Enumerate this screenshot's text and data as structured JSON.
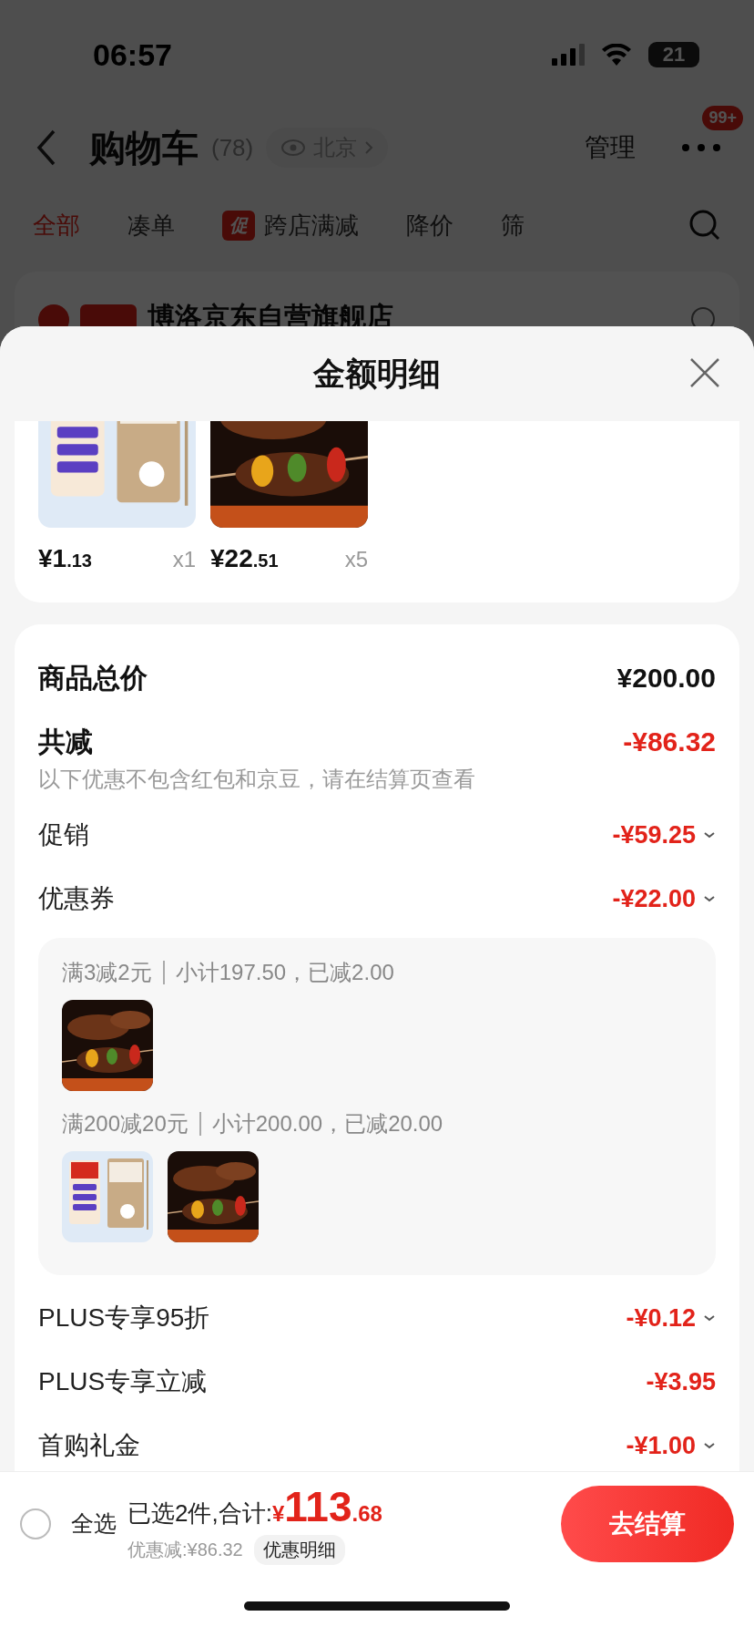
{
  "status_bar": {
    "time": "06:57",
    "battery": "21"
  },
  "header": {
    "title": "购物车",
    "count": "(78)",
    "location": "北京",
    "manage": "管理",
    "badge": "99+"
  },
  "tabs": [
    {
      "label": "全部",
      "selected": true
    },
    {
      "label": "凑单",
      "selected": false
    },
    {
      "label": "跨店满减",
      "tag": "促",
      "selected": false
    },
    {
      "label": "降价",
      "selected": false
    },
    {
      "label": "筛",
      "selected": false
    }
  ],
  "store": {
    "checked": true,
    "name": "博洛京东自营旗舰店"
  },
  "sheet": {
    "title": "金额明细",
    "products": [
      {
        "kind": "swab_box",
        "price": "¥1",
        "cents": ".13",
        "qty": "x1"
      },
      {
        "kind": "kebab",
        "price": "¥22",
        "cents": ".51",
        "qty": "x5"
      }
    ],
    "total": {
      "label": "商品总价",
      "value": "¥200.00"
    },
    "reduction": {
      "label": "共减",
      "value": "-¥86.32",
      "note": "以下优惠不包含红包和京豆，请在结算页查看"
    },
    "rows": [
      {
        "label": "促销",
        "value": "-¥59.25",
        "expandable": true
      },
      {
        "label": "优惠券",
        "value": "-¥22.00",
        "expandable": true,
        "groups": [
          {
            "rule": "满3减2元",
            "detail": "小计197.50，已减2.00",
            "items": [
              {
                "kind": "kebab"
              }
            ]
          },
          {
            "rule": "满200减20元",
            "detail": "小计200.00，已减20.00",
            "items": [
              {
                "kind": "swab_box"
              },
              {
                "kind": "kebab"
              }
            ]
          }
        ]
      },
      {
        "label": "PLUS专享95折",
        "value": "-¥0.12",
        "expandable": true
      },
      {
        "label": "PLUS专享立减",
        "value": "-¥3.95",
        "expandable": false
      },
      {
        "label": "首购礼金",
        "value": "-¥1.00",
        "expandable": true
      }
    ]
  },
  "bottom_bar": {
    "select_all": {
      "label": "全选",
      "checked": false
    },
    "summary": "已选2件,合计:",
    "currency": "¥",
    "amount": "113",
    "cents": ".68",
    "discount": "优惠减:¥86.32",
    "detail_link": "优惠明细",
    "checkout": "去结算"
  }
}
